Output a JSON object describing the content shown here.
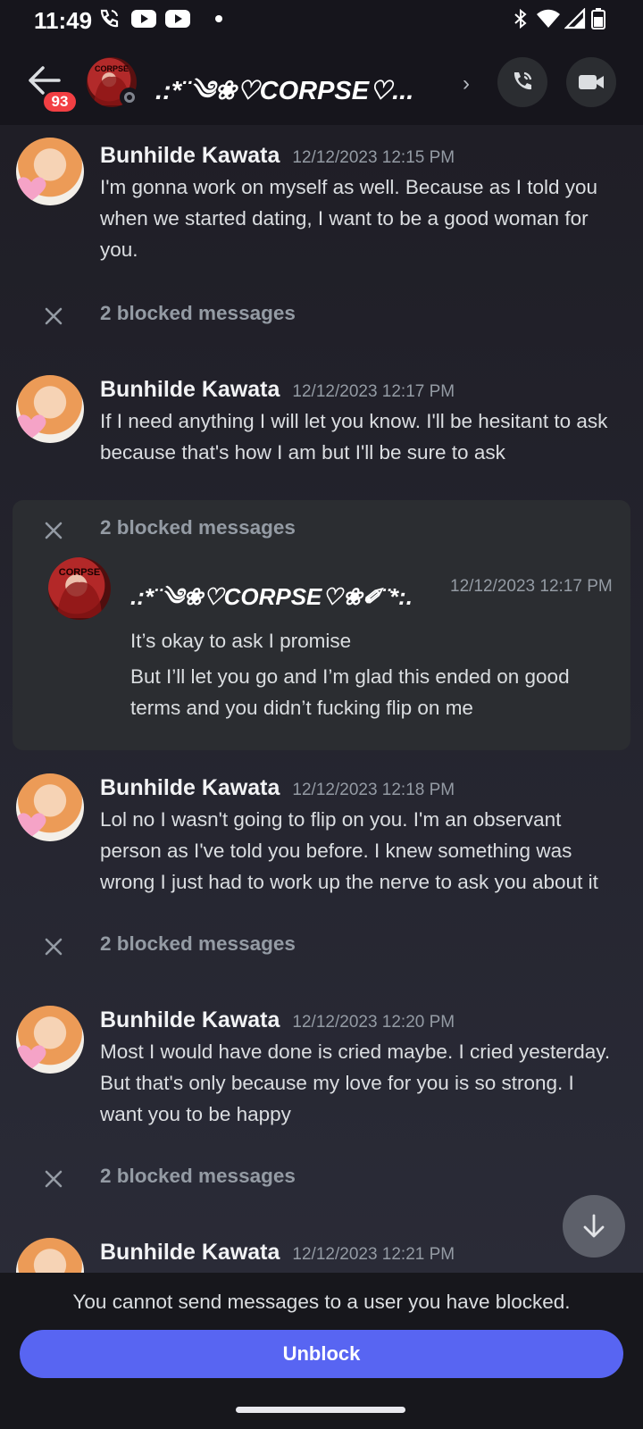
{
  "status_bar": {
    "time": "11:49"
  },
  "header": {
    "badge_count": "93",
    "channel_name": ".:*¨༄❀♡CORPSE♡...",
    "avatar_label": "CORPSE"
  },
  "messages": [
    {
      "author": "Bunhilde Kawata",
      "timestamp": "12/12/2023 12:15 PM",
      "lines": [
        "I'm gonna work on myself as well. Because as I told you",
        "when we started dating, I want to be a good woman for",
        "you."
      ]
    },
    {
      "author": "Bunhilde Kawata",
      "timestamp": "12/12/2023 12:17 PM",
      "lines": [
        "If I need anything I will let you know.  I'll be hesitant to ask",
        "because that's how I am but I'll be sure to ask"
      ]
    },
    {
      "author": "Bunhilde Kawata",
      "timestamp": "12/12/2023 12:18 PM",
      "lines": [
        "Lol no I wasn't going to flip on you. I'm an observant",
        "person as I've told you before. I knew something was",
        "wrong I just had to work up the nerve to ask you about it"
      ]
    },
    {
      "author": "Bunhilde Kawata",
      "timestamp": "12/12/2023 12:20 PM",
      "lines": [
        "Most I would have done is cried maybe. I cried yesterday.",
        "But that's only because my love for you is so strong. I",
        "want you to be happy"
      ]
    },
    {
      "author": "Bunhilde Kawata",
      "timestamp": "12/12/2023 12:21 PM"
    }
  ],
  "blocked_label": "2 blocked messages",
  "expanded_block": {
    "label": "2 blocked messages",
    "author": ".:*¨༄❀♡CORPSE♡❀✐¨*:.",
    "timestamp": "12/12/2023 12:17 PM",
    "lines": [
      "It’s okay to ask I promise",
      "But I’ll let you go and I’m glad this ended on good",
      "terms and you didn’t fucking flip on me"
    ]
  },
  "footer": {
    "note": "You cannot send messages to a user you have blocked.",
    "unblock_label": "Unblock"
  }
}
